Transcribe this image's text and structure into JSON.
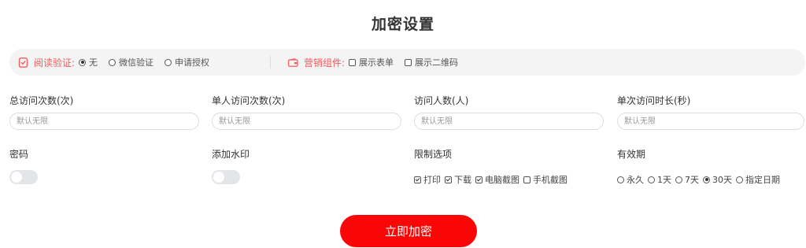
{
  "title": "加密设置",
  "option_bar": {
    "read_verify": {
      "label": "阅读验证:",
      "options": [
        {
          "label": "无",
          "checked": true
        },
        {
          "label": "微信验证",
          "checked": false
        },
        {
          "label": "申请授权",
          "checked": false
        }
      ]
    },
    "marketing": {
      "label": "营销组件:",
      "options": [
        {
          "label": "展示表单",
          "checked": false
        },
        {
          "label": "展示二维码",
          "checked": false
        }
      ]
    }
  },
  "fields": {
    "total_visits": {
      "label": "总访问次数(次)",
      "placeholder": "默认无限"
    },
    "per_user_visits": {
      "label": "单人访问次数(次)",
      "placeholder": "默认无限"
    },
    "visitors": {
      "label": "访问人数(人)",
      "placeholder": "默认无限"
    },
    "visit_duration": {
      "label": "单次访问时长(秒)",
      "placeholder": "默认无限"
    }
  },
  "password": {
    "label": "密码",
    "enabled": false
  },
  "watermark": {
    "label": "添加水印",
    "enabled": false
  },
  "restrictions": {
    "label": "限制选项",
    "options": [
      {
        "label": "打印",
        "checked": true
      },
      {
        "label": "下载",
        "checked": true
      },
      {
        "label": "电脑截图",
        "checked": true
      },
      {
        "label": "手机截图",
        "checked": false
      }
    ]
  },
  "validity": {
    "label": "有效期",
    "options": [
      {
        "label": "永久",
        "checked": false
      },
      {
        "label": "1天",
        "checked": false
      },
      {
        "label": "7天",
        "checked": false
      },
      {
        "label": "30天",
        "checked": true
      },
      {
        "label": "指定日期",
        "checked": false
      }
    ]
  },
  "submit_label": "立即加密",
  "colors": {
    "accent": "#fb0606",
    "label_red": "#f25b5b",
    "bar_bg": "#f4f4f4",
    "toggle_off": "#e3e5e8"
  },
  "icons": {
    "read_verify": "shield-check-icon",
    "marketing": "wallet-icon"
  }
}
